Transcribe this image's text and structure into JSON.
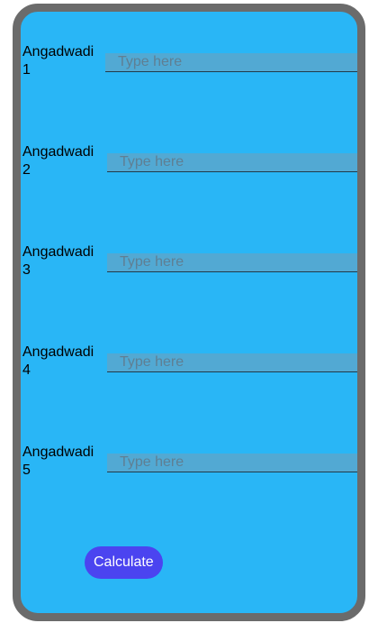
{
  "rows": [
    {
      "label": "Angadwadi 1",
      "placeholder": "Type here",
      "value": ""
    },
    {
      "label": "Angadwadi 2",
      "placeholder": "Type here",
      "value": ""
    },
    {
      "label": "Angadwadi 3",
      "placeholder": "Type here",
      "value": ""
    },
    {
      "label": "Angadwadi 4",
      "placeholder": "Type here",
      "value": ""
    },
    {
      "label": "Angadwadi 5",
      "placeholder": "Type here",
      "value": ""
    }
  ],
  "calculate_label": "Calculate",
  "colors": {
    "background": "#29b6f6",
    "frame": "#6b6b6b",
    "input_bg": "#52a9d3",
    "button": "#4b44f0"
  }
}
